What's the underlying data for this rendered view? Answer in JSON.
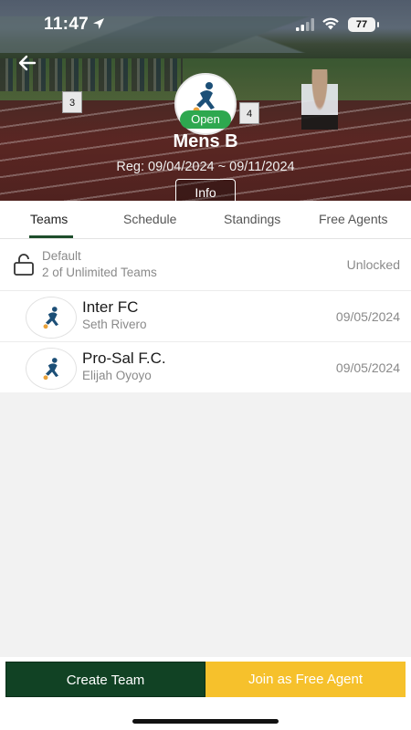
{
  "status_bar": {
    "time": "11:47",
    "battery": "77",
    "icons": [
      "location-arrow-icon",
      "cellular-signal-icon",
      "wifi-icon",
      "battery-icon"
    ]
  },
  "header": {
    "back_icon": "back-arrow-icon",
    "status_badge": "Open",
    "title": "Mens B",
    "registration": "Reg: 09/04/2024 ~ 09/11/2024",
    "info_label": "Info",
    "hurdle_numbers": [
      "3",
      "4"
    ]
  },
  "tabs": [
    {
      "label": "Teams",
      "active": true
    },
    {
      "label": "Schedule",
      "active": false
    },
    {
      "label": "Standings",
      "active": false
    },
    {
      "label": "Free Agents",
      "active": false
    }
  ],
  "group": {
    "icon": "unlock-icon",
    "name": "Default",
    "count": "2 of Unlimited Teams",
    "status": "Unlocked"
  },
  "teams": [
    {
      "name": "Inter FC",
      "captain": "Seth Rivero",
      "date": "09/05/2024"
    },
    {
      "name": "Pro-Sal F.C.",
      "captain": "Elijah Oyoyo",
      "date": "09/05/2024"
    }
  ],
  "actions": {
    "create_team": "Create Team",
    "join_free_agent": "Join as Free Agent"
  },
  "colors": {
    "primary_green": "#114224",
    "accent_yellow": "#f6c12c",
    "open_badge": "#2ea84f",
    "tab_underline": "#1d4d2b"
  }
}
